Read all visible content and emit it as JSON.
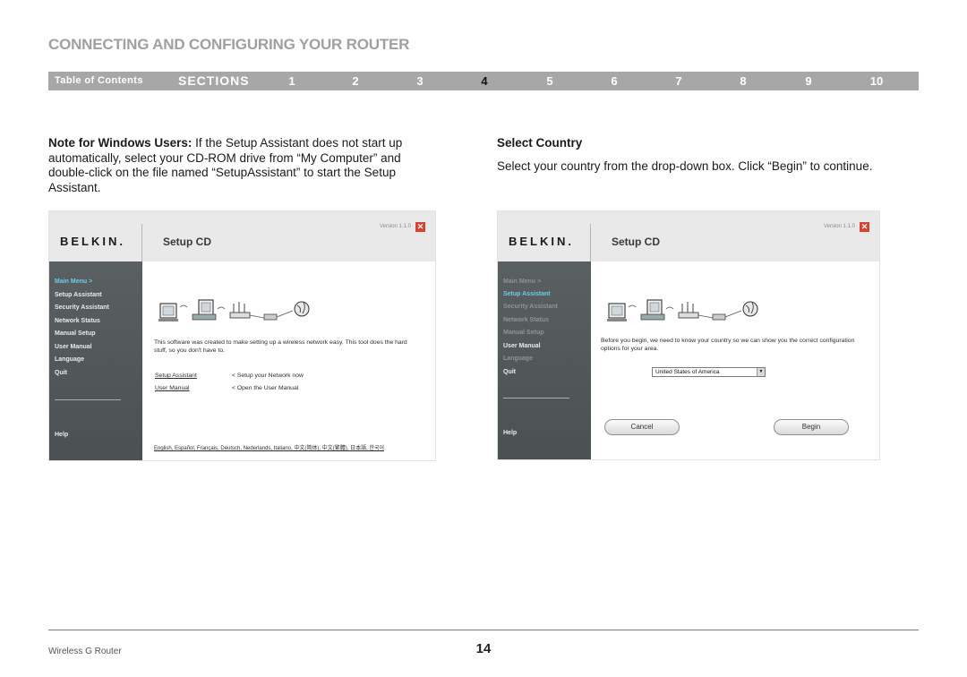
{
  "header": {
    "title": "CONNECTING AND CONFIGURING YOUR ROUTER"
  },
  "nav": {
    "toc": "Table of Contents",
    "sections": "SECTIONS",
    "numbers": [
      "1",
      "2",
      "3",
      "4",
      "5",
      "6",
      "7",
      "8",
      "9",
      "10"
    ],
    "active": "4"
  },
  "left_col": {
    "note_bold": "Note for Windows Users:",
    "note_text": " If the Setup Assistant does not start up automatically, select your CD-ROM drive from “My Computer” and double-click on the file named “SetupAssistant” to start the Setup Assistant."
  },
  "right_col": {
    "heading": "Select Country",
    "text": "Select your country from the drop-down box. Click “Begin” to continue."
  },
  "shot1": {
    "brand": "BELKIN.",
    "title": "Setup CD",
    "version": "Version 1.1.0",
    "menu": [
      "Main Menu  >",
      "Setup Assistant",
      "Security Assistant",
      "Network Status",
      "Manual Setup",
      "User Manual",
      "Language",
      "Quit"
    ],
    "help": "Help",
    "body": "This software was created to make setting up a wireless network easy. This tool does the hard stuff, so you don't have to.",
    "link1": "Setup Assistant",
    "link1_desc": "< Setup your Network now",
    "link2": "User Manual",
    "link2_desc": "< Open the User Manual",
    "languages": "English, Español, Français, Deutsch, Nederlands, Italiano, 中文(简体), 中文(繁體), 日本語, 한국어"
  },
  "shot2": {
    "brand": "BELKIN.",
    "title": "Setup CD",
    "version": "Version 1.1.0",
    "menu": [
      "Main Menu  >",
      "Setup Assistant",
      "Security Assistant",
      "Network Status",
      "Manual Setup",
      "User Manual",
      "Language",
      "Quit"
    ],
    "help": "Help",
    "body": "Before you begin, we need to know your country so we can show you the correct configuration options for your area.",
    "select_value": "United States of America",
    "cancel": "Cancel",
    "begin": "Begin"
  },
  "footer": {
    "product": "Wireless G Router",
    "page": "14"
  },
  "colors": {
    "nav_bg": "#a7a7a7",
    "sidebar_bg": "#5a6062",
    "highlight": "#6bcde8",
    "close_red": "#d8412f"
  }
}
